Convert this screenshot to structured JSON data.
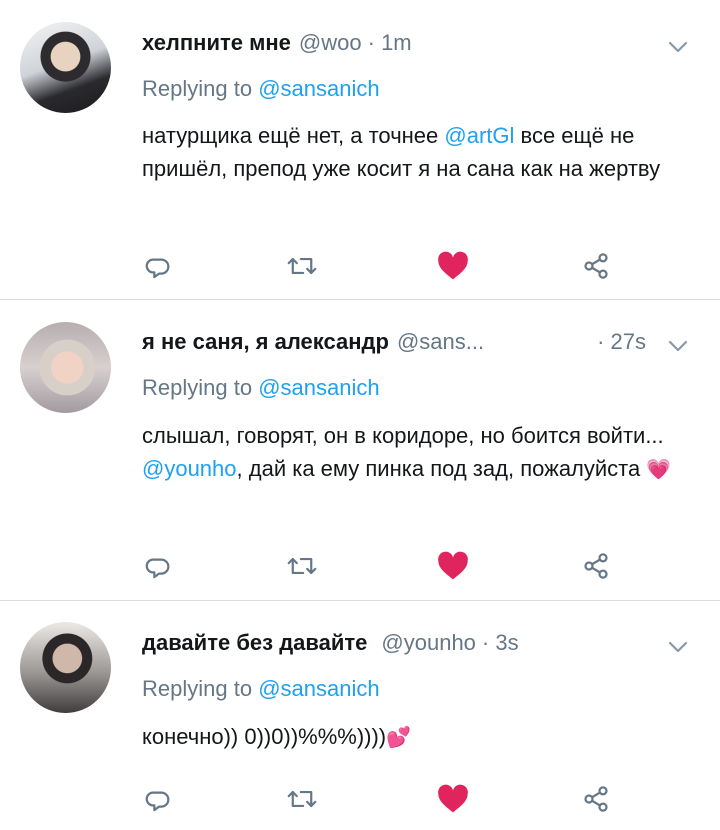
{
  "tweets": [
    {
      "name": "хелпните мне",
      "handle": "@woo",
      "time": "· 1m",
      "replying_prefix": "Replying to",
      "replying_to": "@sansanich",
      "body_parts": [
        "натурщика ещё нет, а точнее ",
        "@artGl",
        " все ещё не пришёл, препод уже косит я на сана как на жертву"
      ],
      "liked": true,
      "avatar_icon": "profile-photo"
    },
    {
      "name": "я не саня, я александр",
      "handle": "@sans...",
      "time": "· 27s",
      "replying_prefix": "Replying to",
      "replying_to": "@sansanich",
      "body_parts": [
        "слышал, говорят, он в коридоре, но боится войти... ",
        "@younho",
        ", дай ка ему пинка под зад, пожалуйста "
      ],
      "body_emoji": "💗",
      "liked": true,
      "avatar_icon": "profile-photo"
    },
    {
      "name": "давайте без давайте",
      "handle": "@younho",
      "time": "· 3s",
      "replying_prefix": "Replying to",
      "replying_to": "@sansanich",
      "body_parts": [
        "конечно)) 0))0))%%%))))"
      ],
      "body_emoji": "💕",
      "liked": true,
      "avatar_icon": "profile-photo"
    }
  ],
  "icons": [
    "chevron-down-icon",
    "reply-icon",
    "retweet-icon",
    "like-icon",
    "share-icon"
  ],
  "colors": {
    "mention": "#1da1f2",
    "secondary": "#657786",
    "like": "#e0245e",
    "text": "#14171a"
  }
}
